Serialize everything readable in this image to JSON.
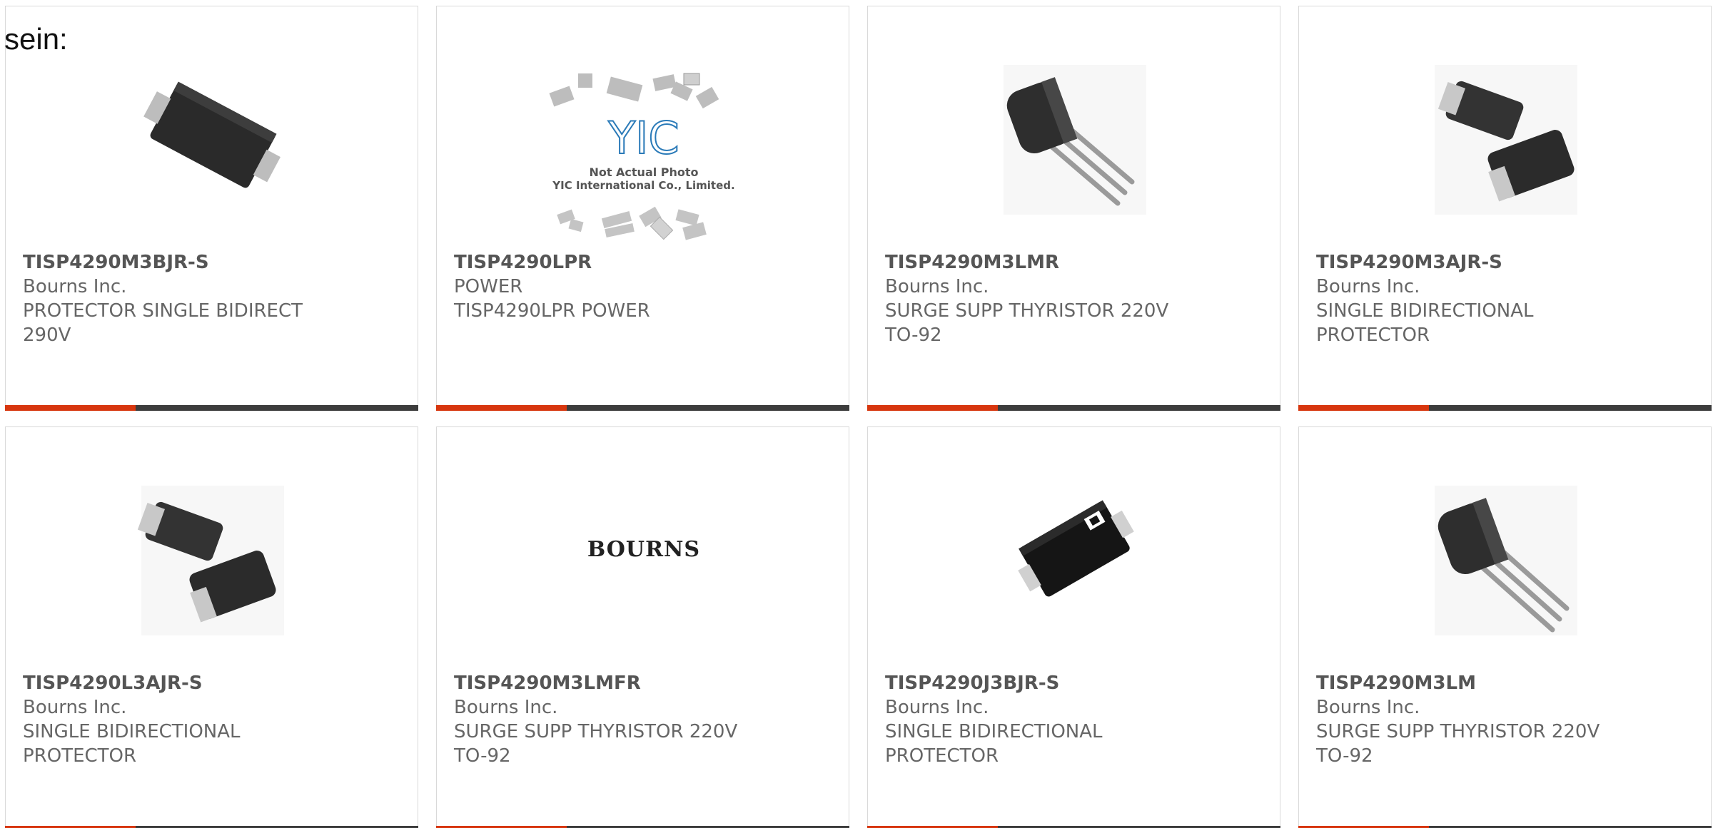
{
  "heading": "sein:",
  "products": [
    {
      "part": "TISP4290M3BJR-S",
      "maker": "Bourns Inc.",
      "desc1": "PROTECTOR SINGLE BIDIRECT",
      "desc2": "290V",
      "image": "smb-diode-package"
    },
    {
      "part": "TISP4290LPR",
      "maker": "POWER",
      "desc1": "TISP4290LPR POWER",
      "desc2": "",
      "image": "not-actual-photo-placeholder",
      "image_caption_1": "Not Actual Photo",
      "image_caption_2": "YIC International Co., Limited.",
      "image_logo": "YIC"
    },
    {
      "part": "TISP4290M3LMR",
      "maker": "Bourns Inc.",
      "desc1": "SURGE SUPP THYRISTOR 220V",
      "desc2": "TO-92",
      "image": "to92-package"
    },
    {
      "part": "TISP4290M3AJR-S",
      "maker": "Bourns Inc.",
      "desc1": "SINGLE BIDIRECTIONAL",
      "desc2": "PROTECTOR",
      "image": "sma-diode-pair"
    },
    {
      "part": "TISP4290L3AJR-S",
      "maker": "Bourns Inc.",
      "desc1": "SINGLE BIDIRECTIONAL",
      "desc2": "PROTECTOR",
      "image": "sma-diode-pair"
    },
    {
      "part": "TISP4290M3LMFR",
      "maker": "Bourns Inc.",
      "desc1": "SURGE SUPP THYRISTOR 220V",
      "desc2": "TO-92",
      "image": "bourns-logo",
      "image_logo": "BOURNS"
    },
    {
      "part": "TISP4290J3BJR-S",
      "maker": "Bourns Inc.",
      "desc1": "SINGLE BIDIRECTIONAL",
      "desc2": "PROTECTOR",
      "image": "smb-diode-package-marked"
    },
    {
      "part": "TISP4290M3LM",
      "maker": "Bourns Inc.",
      "desc1": "SURGE SUPP THYRISTOR 220V",
      "desc2": "TO-92",
      "image": "to92-package"
    }
  ],
  "colors": {
    "accent": "#d7360e",
    "bar": "#3c3c3c",
    "border": "#d9d9d9",
    "text": "#666666"
  }
}
